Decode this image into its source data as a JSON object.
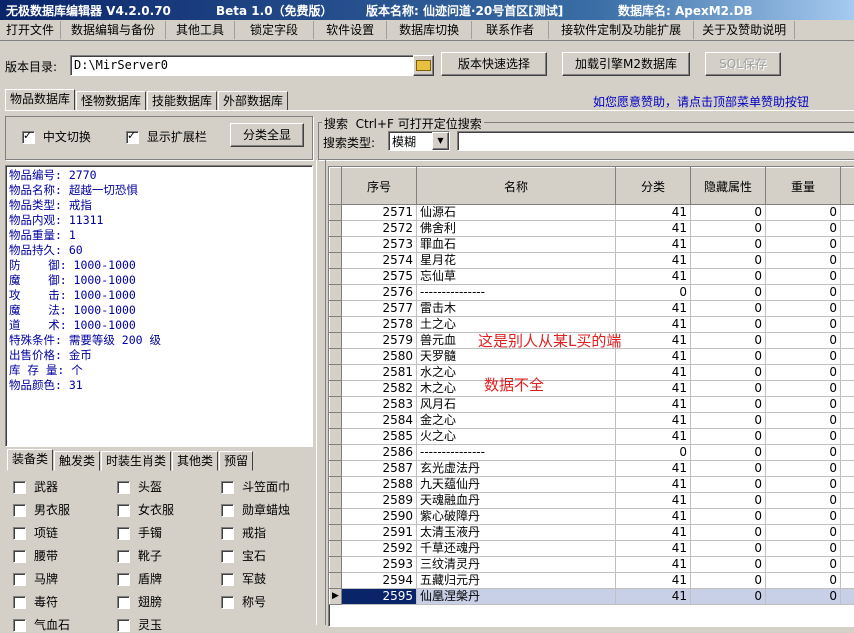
{
  "titlebar": {
    "app_title": "无极数据库编辑器 V4.2.0.70",
    "beta": "Beta 1.0（免费版）",
    "version_name": "版本名称: 仙迹问道·20号首区[测试]",
    "db_name": "数据库名: ApexM2.DB"
  },
  "menu": [
    "打开文件",
    "数据编辑与备份",
    "其他工具",
    "锁定字段",
    "软件设置",
    "数据库切换",
    "联系作者",
    "接软件定制及功能扩展",
    "关于及赞助说明"
  ],
  "toolbar": {
    "dir_label": "版本目录:",
    "dir_value": "D:\\MirServer0",
    "quick_select": "版本快速选择",
    "load_engine": "加载引擎M2数据库",
    "sql_save": "SQL保存"
  },
  "db_tabs": [
    "物品数据库",
    "怪物数据库",
    "技能数据库",
    "外部数据库"
  ],
  "donate_note": "如您愿意赞助，请点击顶部菜单赞助按钮",
  "options": {
    "chinese_toggle": "中文切换",
    "show_extra": "显示扩展栏",
    "show_all_categories": "分类全显"
  },
  "search": {
    "title": "搜索  Ctrl+F 可打开定位搜索",
    "type_label": "搜索类型:",
    "type_value": "模糊"
  },
  "details": [
    "物品编号: 2770",
    "物品名称: 超越一切恐惧",
    "物品类型: 戒指",
    "物品内观: 11311",
    "物品重量: 1",
    "物品持久: 60",
    "防    御: 1000-1000",
    "魔    御: 1000-1000",
    "攻    击: 1000-1000",
    "魔    法: 1000-1000",
    "道    术: 1000-1000",
    "特殊条件: 需要等级 200 级",
    "出售价格: 金币",
    "库 存 量: 个",
    "物品颜色: 31"
  ],
  "category_tabs": [
    "装备类",
    "触发类",
    "时装生肖类",
    "其他类",
    "预留"
  ],
  "categories": [
    [
      "武器",
      "头盔",
      "斗笠面巾"
    ],
    [
      "男衣服",
      "女衣服",
      "勋章蜡烛"
    ],
    [
      "项链",
      "手镯",
      "戒指"
    ],
    [
      "腰带",
      "靴子",
      "宝石"
    ],
    [
      "马牌",
      "盾牌",
      "军鼓"
    ],
    [
      "毒符",
      "翅膀",
      "称号"
    ],
    [
      "气血石",
      "灵玉",
      ""
    ]
  ],
  "grid": {
    "headers": [
      "序号",
      "名称",
      "分类",
      "隐藏属性",
      "重量"
    ],
    "rows": [
      [
        "2571",
        "仙源石",
        "41",
        "0",
        "0"
      ],
      [
        "2572",
        "佛舍利",
        "41",
        "0",
        "0"
      ],
      [
        "2573",
        "罪血石",
        "41",
        "0",
        "0"
      ],
      [
        "2574",
        "星月花",
        "41",
        "0",
        "0"
      ],
      [
        "2575",
        "忘仙草",
        "41",
        "0",
        "0"
      ],
      [
        "2576",
        "---------------",
        "0",
        "0",
        "0"
      ],
      [
        "2577",
        "雷击木",
        "41",
        "0",
        "0"
      ],
      [
        "2578",
        "土之心",
        "41",
        "0",
        "0"
      ],
      [
        "2579",
        "兽元血",
        "41",
        "0",
        "0"
      ],
      [
        "2580",
        "天罗髓",
        "41",
        "0",
        "0"
      ],
      [
        "2581",
        "水之心",
        "41",
        "0",
        "0"
      ],
      [
        "2582",
        "木之心",
        "41",
        "0",
        "0"
      ],
      [
        "2583",
        "风月石",
        "41",
        "0",
        "0"
      ],
      [
        "2584",
        "金之心",
        "41",
        "0",
        "0"
      ],
      [
        "2585",
        "火之心",
        "41",
        "0",
        "0"
      ],
      [
        "2586",
        "---------------",
        "0",
        "0",
        "0"
      ],
      [
        "2587",
        "玄光虚法丹",
        "41",
        "0",
        "0"
      ],
      [
        "2588",
        "九天蕴仙丹",
        "41",
        "0",
        "0"
      ],
      [
        "2589",
        "天魂融血丹",
        "41",
        "0",
        "0"
      ],
      [
        "2590",
        "紫心破障丹",
        "41",
        "0",
        "0"
      ],
      [
        "2591",
        "太清玉液丹",
        "41",
        "0",
        "0"
      ],
      [
        "2592",
        "千草还魂丹",
        "41",
        "0",
        "0"
      ],
      [
        "2593",
        "三纹清灵丹",
        "41",
        "0",
        "0"
      ],
      [
        "2594",
        "五藏归元丹",
        "41",
        "0",
        "0"
      ],
      [
        "2595",
        "仙凰涅槃丹",
        "41",
        "0",
        "0"
      ]
    ],
    "selected_index": 24
  },
  "annotations": {
    "note1": "这是别人从某L买的端",
    "note2": "数据不全"
  }
}
